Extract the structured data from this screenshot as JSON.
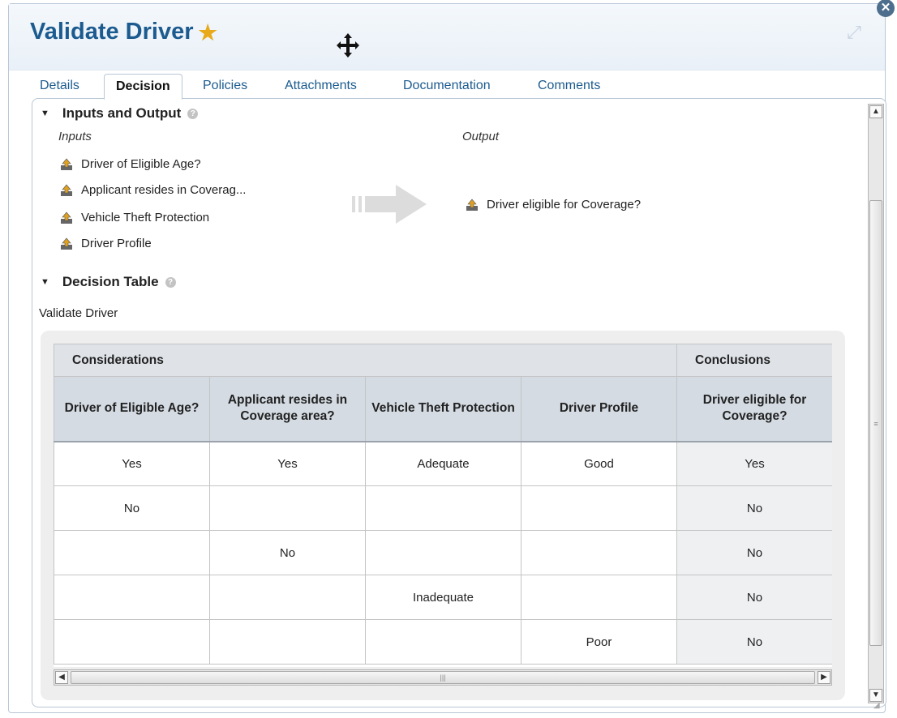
{
  "window": {
    "title": "Validate Driver",
    "star_icon": "star-icon",
    "close_icon": "close-icon",
    "expand_icon": "expand-icon",
    "move_cursor_icon": "move-cursor-icon"
  },
  "tabs": [
    {
      "label": "Details",
      "active": false
    },
    {
      "label": "Decision",
      "active": true
    },
    {
      "label": "Policies",
      "active": false
    },
    {
      "label": "Attachments",
      "active": false
    },
    {
      "label": "Documentation",
      "active": false
    },
    {
      "label": "Comments",
      "active": false
    }
  ],
  "inputs_output": {
    "heading": "Inputs and Output",
    "inputs_label": "Inputs",
    "output_label": "Output",
    "inputs": [
      "Driver of Eligible Age?",
      "Applicant resides in Coverag...",
      "Vehicle Theft Protection",
      "Driver Profile"
    ],
    "output": "Driver eligible for Coverage?"
  },
  "decision_table": {
    "heading": "Decision Table",
    "name": "Validate Driver",
    "considerations_label": "Considerations",
    "conclusions_label": "Conclusions",
    "columns": [
      "Driver of Eligible Age?",
      "Applicant resides in Coverage area?",
      "Vehicle Theft Protection",
      "Driver Profile",
      "Driver eligible for Coverage?"
    ],
    "rows": [
      [
        "Yes",
        "Yes",
        "Adequate",
        "Good",
        "Yes"
      ],
      [
        "No",
        "",
        "",
        "",
        "No"
      ],
      [
        "",
        "No",
        "",
        "",
        "No"
      ],
      [
        "",
        "",
        "Inadequate",
        "",
        "No"
      ],
      [
        "",
        "",
        "",
        "Poor",
        "No"
      ]
    ]
  },
  "colors": {
    "title": "#1c5b8f",
    "tab_link": "#1c5b8f",
    "star": "#e8a91a",
    "header_bg": "#d4dbe3",
    "conclusion_bg": "#eef0f2"
  }
}
